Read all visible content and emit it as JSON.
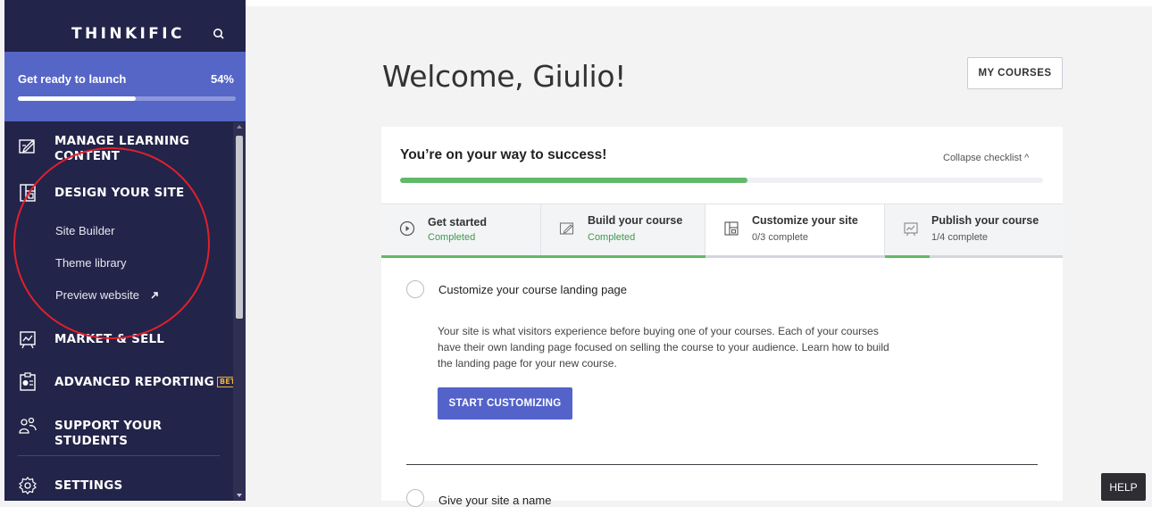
{
  "sidebar": {
    "brand": "THINKIFIC",
    "launch": {
      "label": "Get ready to launch",
      "percent_label": "54%",
      "progress": 0.54
    },
    "nav": [
      {
        "label": "MANAGE LEARNING CONTENT",
        "icon": "edit-icon"
      },
      {
        "label": "DESIGN YOUR SITE",
        "icon": "layout-icon",
        "subitems": [
          "Site Builder",
          "Theme library",
          "Preview website"
        ]
      },
      {
        "label": "MARKET & SELL",
        "icon": "chart-board-icon"
      },
      {
        "label": "ADVANCED REPORTING",
        "badge": "BETA",
        "icon": "report-icon"
      },
      {
        "label": "SUPPORT YOUR STUDENTS",
        "icon": "people-icon"
      },
      {
        "label": "SETTINGS",
        "icon": "gear-icon"
      }
    ]
  },
  "main": {
    "title": "Welcome, Giulio!",
    "my_courses": "MY COURSES",
    "checklist": {
      "title": "You’re on your way to success!",
      "collapse_label": "Collapse checklist ^",
      "progress": 0.54,
      "tabs": [
        {
          "title": "Get started",
          "status": "Completed",
          "progress": 1.0
        },
        {
          "title": "Build your course",
          "status": "Completed",
          "progress": 1.0
        },
        {
          "title": "Customize your site",
          "status": "0/3 complete",
          "progress": 0.0
        },
        {
          "title": "Publish your course",
          "status": "1/4 complete",
          "progress": 0.25
        }
      ],
      "tasks": [
        {
          "title": "Customize your course landing page",
          "description": "Your site is what visitors experience before buying one of your courses. Each of your courses have their own landing page focused on selling the course to your audience. Learn how to build the landing page for your new course.",
          "cta": "START CUSTOMIZING"
        },
        {
          "title": "Give your site a name"
        }
      ]
    },
    "help": "HELP"
  },
  "colors": {
    "sidebar_bg": "#232449",
    "launch_bg": "#5566c7",
    "success_green": "#62b96a",
    "primary_button": "#5463c9",
    "annotation_red": "#e0202c"
  }
}
